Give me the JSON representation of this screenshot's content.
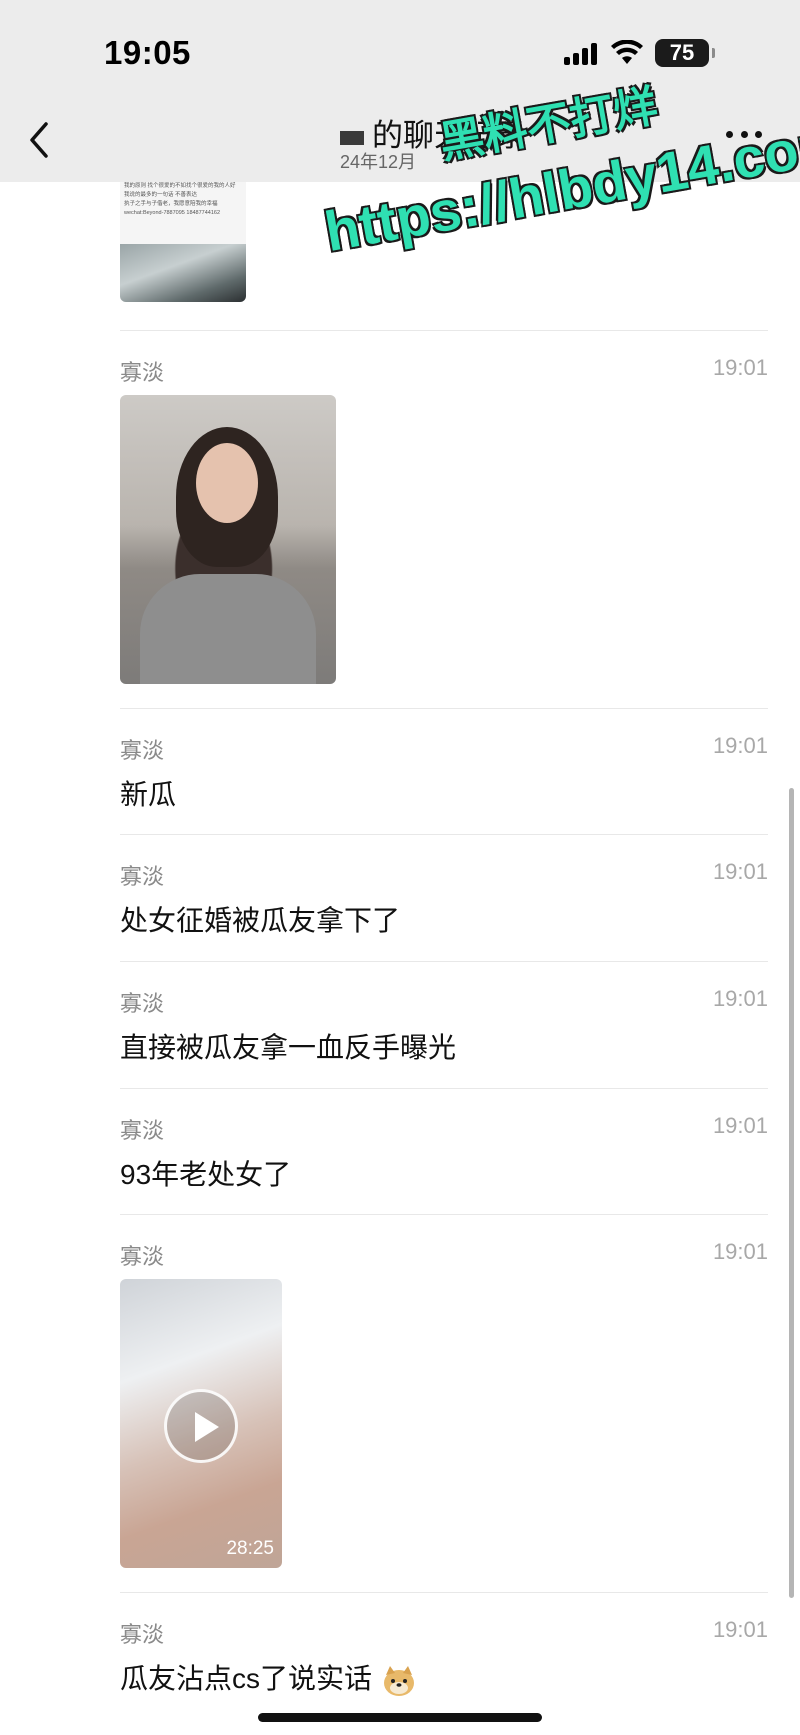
{
  "status_bar": {
    "time": "19:05",
    "battery": "75"
  },
  "nav": {
    "title": "的聊天记录",
    "subtitle": "24年12月"
  },
  "partial_message": {
    "text_lines": [
      "我的原则 找个很爱的不如找个很爱的我的人好",
      "我说的最多的一句话 不善表达",
      "执子之手与子偕老，我愿意陪我的幸福",
      "wechat:Beyond-7887095 18487744162"
    ]
  },
  "messages": [
    {
      "sender": "寡淡",
      "time": "19:01",
      "type": "image"
    },
    {
      "sender": "寡淡",
      "time": "19:01",
      "type": "text",
      "text": "新瓜"
    },
    {
      "sender": "寡淡",
      "time": "19:01",
      "type": "text",
      "text": "处女征婚被瓜友拿下了"
    },
    {
      "sender": "寡淡",
      "time": "19:01",
      "type": "text",
      "text": "直接被瓜友拿一血反手曝光"
    },
    {
      "sender": "寡淡",
      "time": "19:01",
      "type": "text",
      "text": "93年老处女了"
    },
    {
      "sender": "寡淡",
      "time": "19:01",
      "type": "video",
      "duration": "28:25"
    },
    {
      "sender": "寡淡",
      "time": "19:01",
      "type": "text",
      "text": "瓜友沾点cs了说实话",
      "emoji": "doge-emoji"
    }
  ],
  "watermark": {
    "line1": "黑料不打烊",
    "line2": "https://hlbdy14.com"
  },
  "colors": {
    "header_bg": "#ececec",
    "divider": "#e8e8e8",
    "watermark": "#2fe0b2"
  }
}
